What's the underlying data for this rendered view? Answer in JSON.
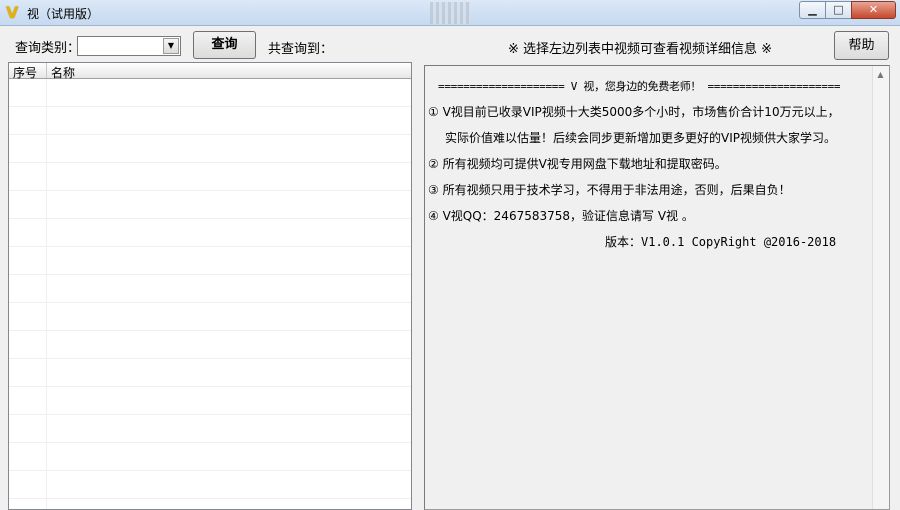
{
  "window": {
    "app_icon_glyph": "V",
    "title": "视（试用版）",
    "minimize_glyph": "▁",
    "maximize_glyph": "□",
    "close_glyph": "✕"
  },
  "toolbar": {
    "category_label": "查询类别：",
    "category_value": "",
    "dropdown_glyph": "▼",
    "query_button": "查询",
    "result_count": "共查询到：",
    "hint": "※ 选择左边列表中视频可查看视频详细信息 ※",
    "help_button": "帮助"
  },
  "list": {
    "columns": [
      "序号",
      "名称"
    ],
    "rows": []
  },
  "info": {
    "banner": "==================== V 视，您身边的免费老师！ =====================",
    "line1": "① V视目前已收录VIP视频十大类5000多个小时，市场售价合计10万元以上，",
    "line1b": "实际价值难以估量！后续会同步更新增加更多更好的VIP视频供大家学习。",
    "line2": "② 所有视频均可提供V视专用网盘下载地址和提取密码。",
    "line3": "③ 所有视频只用于技术学习，不得用于非法用途，否则，后果自负！",
    "line4": "④ V视QQ：2467583758，验证信息请写 V视 。",
    "version": "版本：V1.0.1   CopyRight @2016-2018"
  },
  "colors": {
    "icon_accent": "#e7b200",
    "close_button": "#c7472d",
    "window_bg": "#f0f0f0"
  }
}
